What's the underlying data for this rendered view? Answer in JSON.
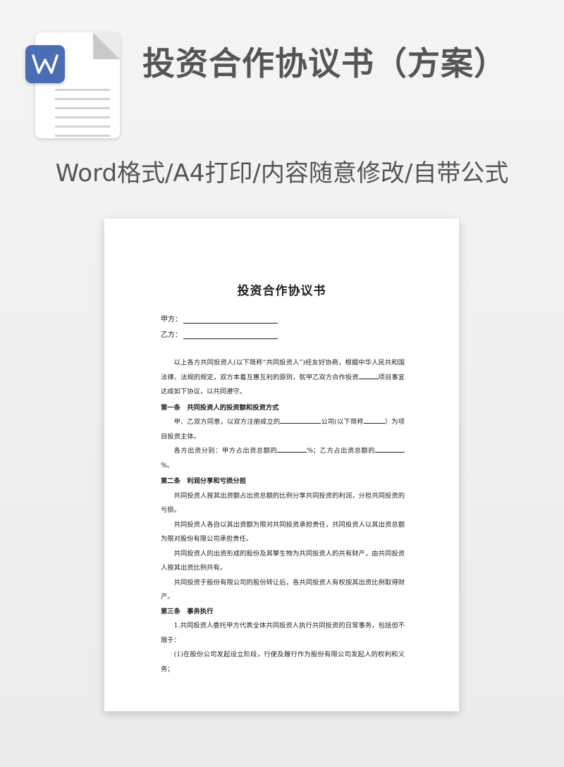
{
  "header": {
    "title": "投资合作协议书（方案）",
    "subtitle": "Word格式/A4打印/内容随意修改/自带公式",
    "icon": "word-document-icon",
    "accent_color": "#4a6eb5"
  },
  "document": {
    "title": "投资合作协议书",
    "party_a_label": "甲方：",
    "party_b_label": "乙方：",
    "intro_1": "以上各方共同投资人(以下简称“共同投资人”)经友好协商，根据中华人民共和国法律、法规的规定，双方本着互惠互利的原则，就甲乙双方合作投资",
    "intro_2": "项目事宜达成如下协议，以共同遵守。",
    "article1_heading": "第一条　共同投资人的投资额和投资方式",
    "a1_p1_a": "甲、乙双方同意，以双方注册成立的",
    "a1_p1_b": "公司(以下简称",
    "a1_p1_c": "）为项目投资主体。",
    "a1_p2_a": "各方出资分别：甲方占出资总额的",
    "a1_p2_b": "%；乙方占出资总额的",
    "a1_p2_c": "%。",
    "article2_heading": "第二条　利润分享和亏损分担",
    "a2_p1": "共同投资人按其出资额占出资总额的比例分享共同投资的利润，分担共同投资的亏损。",
    "a2_p2": "共同投资人各自以其出资额为限对共同投资承担责任，共同投资人以其出资总额为限对股份有限公司承担责任。",
    "a2_p3": "共同投资人的出资形成的股份及其孳生物为共同投资人的共有财产，由共同投资人按其出资比例共有。",
    "a2_p4": "共同投资于股份有限公司的股份转让后，各共同投资人有权按其出资比例取得财产。",
    "article3_heading": "第三条　事务执行",
    "a3_p1": "1.共同投资人委托甲方代表全体共同投资人执行共同投资的日常事务，包括但不限于：",
    "a3_p2": "(1)在股份公司发起设立阶段，行使及履行作为股份有限公司发起人的权利和义务；"
  }
}
